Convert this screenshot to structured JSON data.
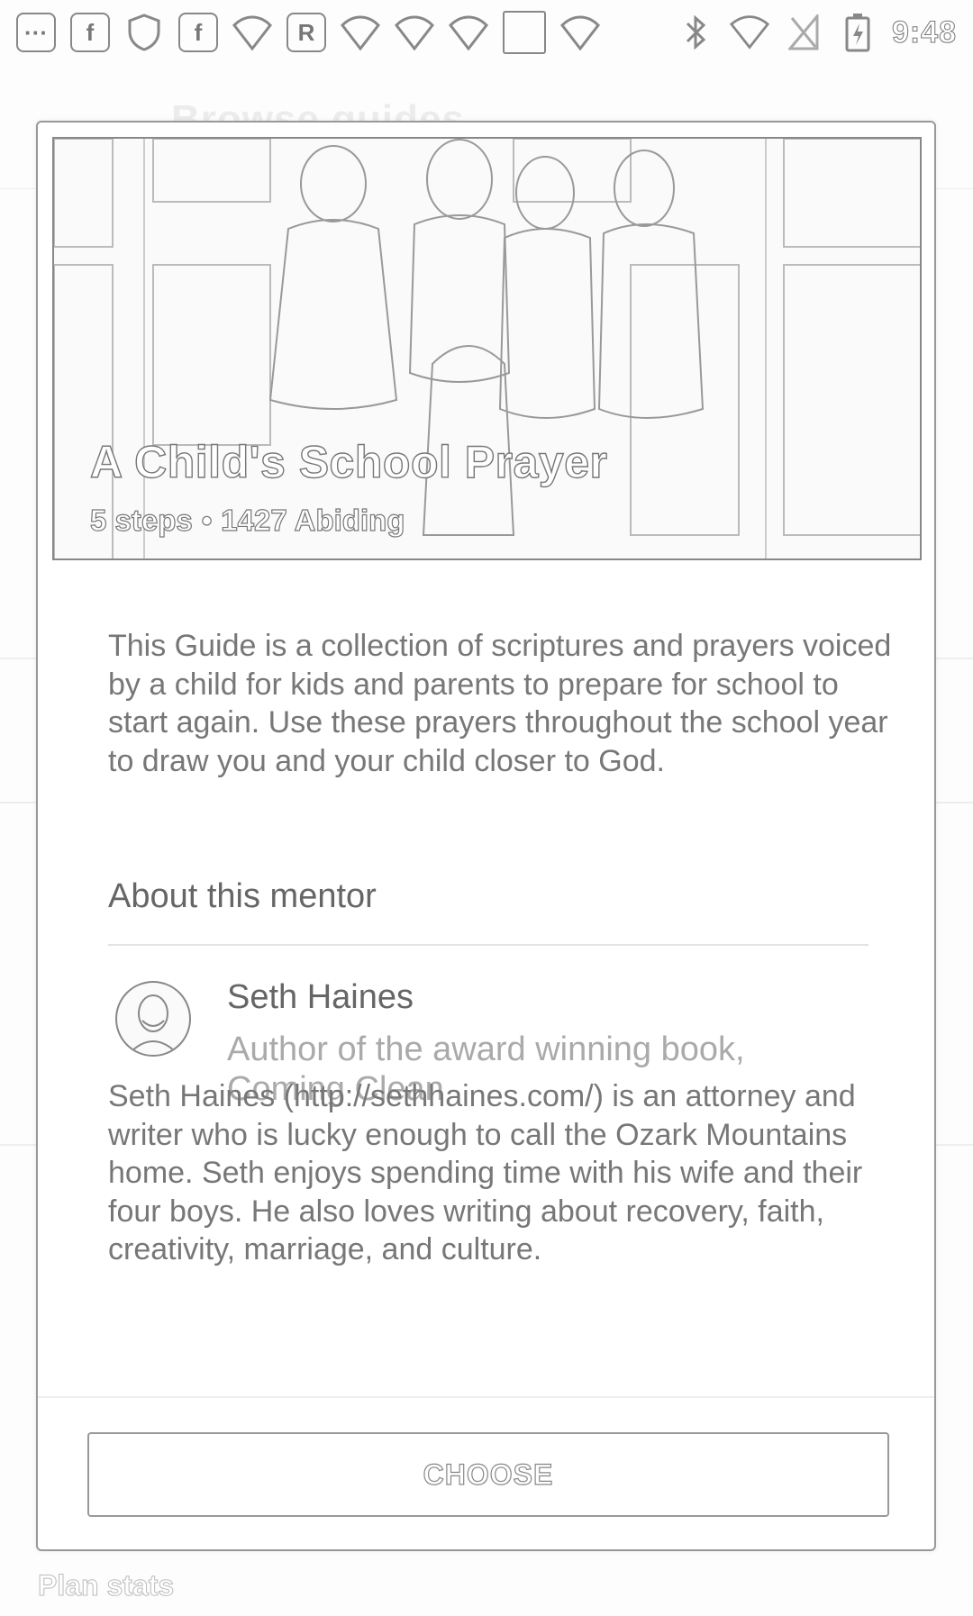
{
  "status_bar": {
    "left_icons": [
      "more-icon",
      "facebook-icon",
      "shield-icon",
      "facebook-icon",
      "wifi-icon",
      "r-icon",
      "wifi-icon",
      "wifi-icon",
      "wifi-icon",
      "blank-square-icon",
      "wifi-icon"
    ],
    "r_label": "R",
    "fb_label": "f",
    "more_label": "···",
    "right_icons": [
      "bluetooth-icon",
      "wifi-signal-icon",
      "no-sim-icon",
      "battery-charging-icon"
    ],
    "time": "9:48"
  },
  "background": {
    "title": "Browse guides",
    "footer_text": "Plan stats"
  },
  "dialog": {
    "title": "A Child's School Prayer",
    "steps": "5 steps",
    "separator": "•",
    "abiding": "1427 Abiding",
    "description": "This Guide is a collection of scriptures and prayers voiced by a child for kids and parents to prepare for school to start again. Use these prayers throughout the school year to draw you and your child closer to God.",
    "section_title": "About this mentor",
    "mentor": {
      "name": "Seth Haines",
      "subtitle": "Author of the award winning book, Coming Clean",
      "bio": "Seth Haines (http://sethhaines.com/) is an attorney and writer who is lucky enough to call the Ozark Mountains home. Seth enjoys spending time with his wife and their four boys. He also loves writing about recovery, faith, creativity, marriage, and culture."
    },
    "choose_label": "CHOOSE"
  }
}
